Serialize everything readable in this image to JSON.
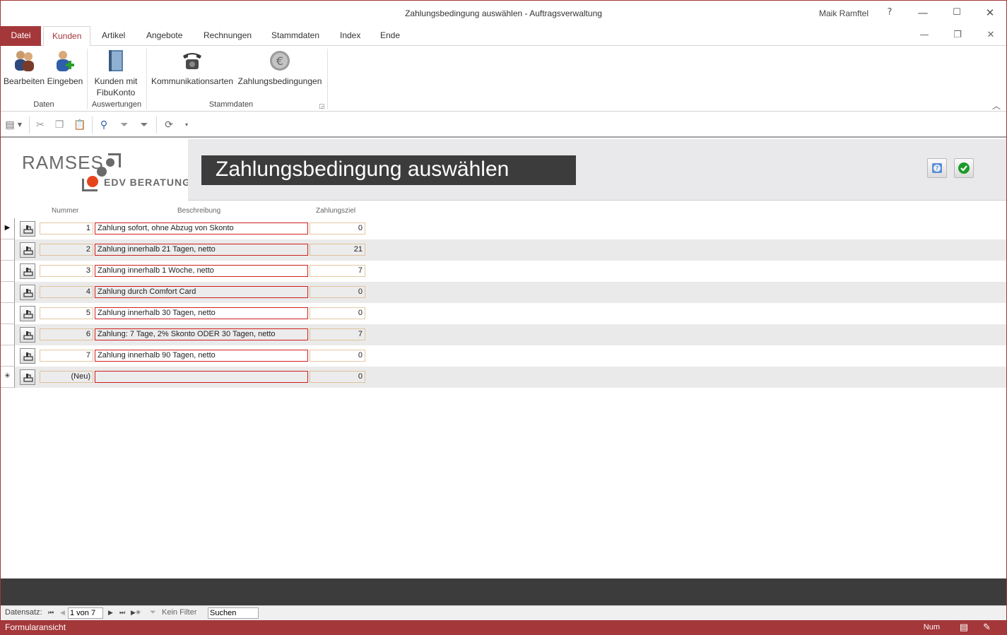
{
  "window": {
    "title": "Zahlungsbedingung auswählen  -  Auftragsverwaltung",
    "user": "Maik Ramftel",
    "help": "?",
    "minimize": "—",
    "maximize": "☐",
    "close": "✕"
  },
  "menu": {
    "file": "Datei",
    "tabs": [
      "Kunden",
      "Artikel",
      "Angebote",
      "Rechnungen",
      "Stammdaten",
      "Index",
      "Ende"
    ],
    "active_tab": "Kunden"
  },
  "ribbon": {
    "buttons": {
      "bearbeiten": "Bearbeiten",
      "eingeben": "Eingeben",
      "kunden_fibu_1": "Kunden mit",
      "kunden_fibu_2": "FibuKonto",
      "kommunikationsarten": "Kommunikationsarten",
      "zahlungsbedingungen": "Zahlungsbedingungen"
    },
    "groups": {
      "daten": "Daten",
      "auswertungen": "Auswertungen",
      "stammdaten": "Stammdaten"
    }
  },
  "form": {
    "logo_top": "RAMSES",
    "logo_bottom": "EDV BERATUNG",
    "title": "Zahlungsbedingung auswählen",
    "columns": {
      "nummer": "Nummer",
      "beschreibung": "Beschreibung",
      "zahlungsziel": "Zahlungsziel"
    },
    "rows": [
      {
        "nummer": "1",
        "beschreibung": "Zahlung sofort, ohne Abzug von Skonto",
        "zahlungsziel": "0",
        "selector": "▶"
      },
      {
        "nummer": "2",
        "beschreibung": "Zahlung innerhalb 21 Tagen, netto",
        "zahlungsziel": "21",
        "selector": ""
      },
      {
        "nummer": "3",
        "beschreibung": "Zahlung innerhalb 1 Woche, netto",
        "zahlungsziel": "7",
        "selector": ""
      },
      {
        "nummer": "4",
        "beschreibung": "Zahlung durch Comfort Card",
        "zahlungsziel": "0",
        "selector": ""
      },
      {
        "nummer": "5",
        "beschreibung": "Zahlung innerhalb 30 Tagen, netto",
        "zahlungsziel": "0",
        "selector": ""
      },
      {
        "nummer": "6",
        "beschreibung": "Zahlung: 7 Tage, 2% Skonto  ODER 30 Tagen, netto",
        "zahlungsziel": "7",
        "selector": ""
      },
      {
        "nummer": "7",
        "beschreibung": "Zahlung innerhalb 90 Tagen, netto",
        "zahlungsziel": "0",
        "selector": ""
      },
      {
        "nummer": "(Neu)",
        "beschreibung": "",
        "zahlungsziel": "0",
        "selector": "✳"
      }
    ]
  },
  "navigation": {
    "label": "Datensatz:",
    "record": "1 von 7",
    "filter": "Kein Filter",
    "search": "Suchen"
  },
  "status": {
    "view": "Formularansicht",
    "num": "Num"
  },
  "colors": {
    "accent": "#a4373a",
    "header_dark": "#3c3c3c"
  }
}
